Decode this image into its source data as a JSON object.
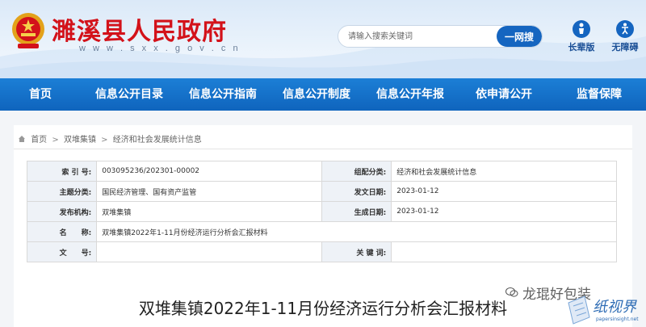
{
  "header": {
    "site_title": "濉溪县人民政府",
    "site_url": "w w w . s x x . g o v . c n",
    "search": {
      "placeholder": "请输入搜索关键词",
      "button_label": "一网搜"
    },
    "tools": [
      {
        "label": "长辈版",
        "icon": "elder-icon"
      },
      {
        "label": "无障碍",
        "icon": "accessibility-icon"
      }
    ],
    "colors": {
      "title_red": "#d3121a",
      "brand_blue": "#1565c0"
    }
  },
  "nav": {
    "items": [
      {
        "label": "首页"
      },
      {
        "label": "信息公开目录"
      },
      {
        "label": "信息公开指南"
      },
      {
        "label": "信息公开制度"
      },
      {
        "label": "信息公开年报"
      },
      {
        "label": "依申请公开"
      },
      {
        "label": "监督保障"
      }
    ]
  },
  "breadcrumb": {
    "items": [
      "首页",
      "双堆集镇",
      "经济和社会发展统计信息"
    ],
    "separator": ">"
  },
  "meta": {
    "index_label": "索 引 号:",
    "index_value": "003095236/202301-00002",
    "category_label": "组配分类:",
    "category_value": "经济和社会发展统计信息",
    "topic_label": "主题分类:",
    "topic_value": "国民经济管理、国有资产监管",
    "date_label": "发文日期:",
    "date_value": "2023-01-12",
    "org_label": "发布机构:",
    "org_value": "双堆集镇",
    "gen_date_label": "生成日期:",
    "gen_date_value": "2023-01-12",
    "name_label": "名　　称:",
    "name_value": "双堆集镇2022年1-11月份经济运行分析会汇报材料",
    "doc_no_label": "文　　号:",
    "doc_no_value": "",
    "keywords_label": "关 键 词:",
    "keywords_value": ""
  },
  "document": {
    "title": "双堆集镇2022年1-11月份经济运行分析会汇报材料"
  },
  "watermark": {
    "account": "龙琨好包装",
    "logo_text": "纸视界",
    "logo_url": "papersinsight.net"
  }
}
